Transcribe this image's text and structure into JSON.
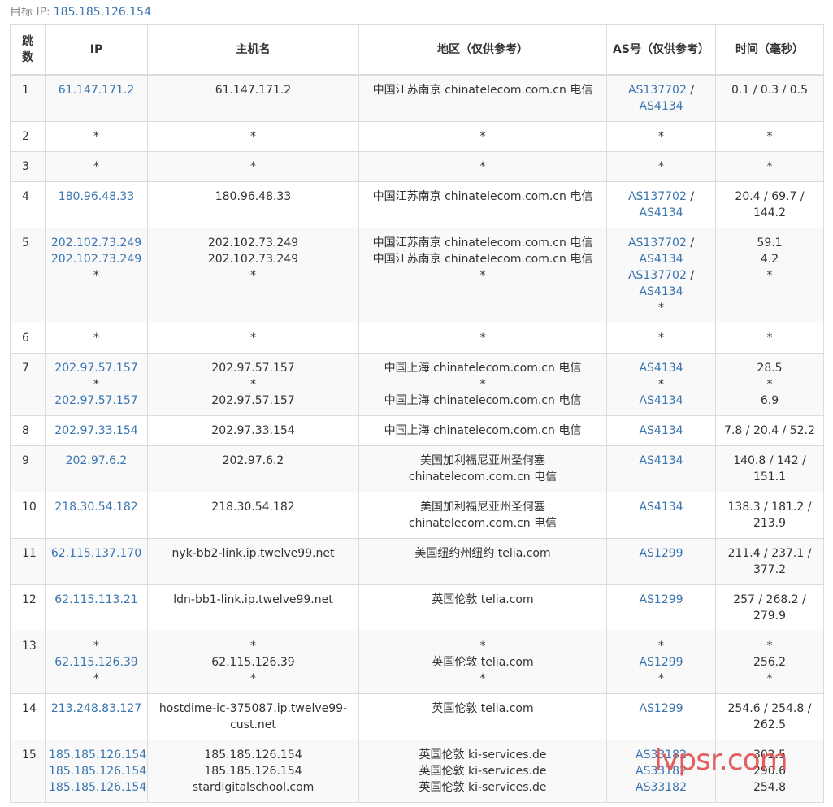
{
  "target": {
    "label": "目标 IP:",
    "ip": "185.185.126.154"
  },
  "headers": [
    "跳数",
    "IP",
    "主机名",
    "地区（仅供参考）",
    "AS号（仅供参考）",
    "时间（毫秒）"
  ],
  "rows": [
    {
      "hop": "1",
      "ip": [
        "61.147.171.2"
      ],
      "host": [
        "61.147.171.2"
      ],
      "region": [
        "中国江苏南京 chinatelecom.com.cn 电信"
      ],
      "as": [
        {
          "a": "AS137702",
          "sep": " /"
        },
        {
          "a": "AS4134"
        }
      ],
      "time": [
        "0.1 / 0.3 / 0.5"
      ]
    },
    {
      "hop": "2",
      "ip": [
        "*"
      ],
      "host": [
        "*"
      ],
      "region": [
        "*"
      ],
      "as": [
        {
          "t": "*"
        }
      ],
      "time": [
        "*"
      ]
    },
    {
      "hop": "3",
      "ip": [
        "*"
      ],
      "host": [
        "*"
      ],
      "region": [
        "*"
      ],
      "as": [
        {
          "t": "*"
        }
      ],
      "time": [
        "*"
      ]
    },
    {
      "hop": "4",
      "ip": [
        "180.96.48.33"
      ],
      "host": [
        "180.96.48.33"
      ],
      "region": [
        "中国江苏南京 chinatelecom.com.cn 电信"
      ],
      "as": [
        {
          "a": "AS137702",
          "sep": " /"
        },
        {
          "a": "AS4134"
        }
      ],
      "time": [
        "20.4 / 69.7 /",
        "144.2"
      ]
    },
    {
      "hop": "5",
      "ip": [
        "202.102.73.249",
        "202.102.73.249",
        "*"
      ],
      "host": [
        "202.102.73.249",
        "202.102.73.249",
        "*"
      ],
      "region": [
        "中国江苏南京 chinatelecom.com.cn 电信",
        "中国江苏南京 chinatelecom.com.cn 电信",
        "*"
      ],
      "as": [
        {
          "a": "AS137702",
          "sep": " /"
        },
        {
          "a": "AS4134"
        },
        {
          "a": "AS137702",
          "sep": " /"
        },
        {
          "a": "AS4134"
        },
        {
          "t": "*"
        }
      ],
      "time": [
        "59.1",
        "4.2",
        "*"
      ]
    },
    {
      "hop": "6",
      "ip": [
        "*"
      ],
      "host": [
        "*"
      ],
      "region": [
        "*"
      ],
      "as": [
        {
          "t": "*"
        }
      ],
      "time": [
        "*"
      ]
    },
    {
      "hop": "7",
      "ip": [
        "202.97.57.157",
        "*",
        "202.97.57.157"
      ],
      "host": [
        "202.97.57.157",
        "*",
        "202.97.57.157"
      ],
      "region": [
        "中国上海 chinatelecom.com.cn 电信",
        "*",
        "中国上海 chinatelecom.com.cn 电信"
      ],
      "as": [
        {
          "a": "AS4134"
        },
        {
          "t": "*"
        },
        {
          "a": "AS4134"
        }
      ],
      "time": [
        "28.5",
        "*",
        "6.9"
      ]
    },
    {
      "hop": "8",
      "ip": [
        "202.97.33.154"
      ],
      "host": [
        "202.97.33.154"
      ],
      "region": [
        "中国上海 chinatelecom.com.cn 电信"
      ],
      "as": [
        {
          "a": "AS4134"
        }
      ],
      "time": [
        "7.8 / 20.4 / 52.2"
      ]
    },
    {
      "hop": "9",
      "ip": [
        "202.97.6.2"
      ],
      "host": [
        "202.97.6.2"
      ],
      "region": [
        "美国加利福尼亚州圣何塞",
        "chinatelecom.com.cn 电信"
      ],
      "as": [
        {
          "a": "AS4134"
        }
      ],
      "time": [
        "140.8 / 142 /",
        "151.1"
      ]
    },
    {
      "hop": "10",
      "ip": [
        "218.30.54.182"
      ],
      "host": [
        "218.30.54.182"
      ],
      "region": [
        "美国加利福尼亚州圣何塞",
        "chinatelecom.com.cn 电信"
      ],
      "as": [
        {
          "a": "AS4134"
        }
      ],
      "time": [
        "138.3 / 181.2 /",
        "213.9"
      ]
    },
    {
      "hop": "11",
      "ip": [
        "62.115.137.170"
      ],
      "host": [
        "nyk-bb2-link.ip.twelve99.net"
      ],
      "region": [
        "美国纽约州纽约 telia.com"
      ],
      "as": [
        {
          "a": "AS1299"
        }
      ],
      "time": [
        "211.4 / 237.1 /",
        "377.2"
      ]
    },
    {
      "hop": "12",
      "ip": [
        "62.115.113.21"
      ],
      "host": [
        "ldn-bb1-link.ip.twelve99.net"
      ],
      "region": [
        "英国伦敦 telia.com"
      ],
      "as": [
        {
          "a": "AS1299"
        }
      ],
      "time": [
        "257 / 268.2 /",
        "279.9"
      ]
    },
    {
      "hop": "13",
      "ip": [
        "*",
        "62.115.126.39",
        "*"
      ],
      "host": [
        "*",
        "62.115.126.39",
        "*"
      ],
      "region": [
        "*",
        "英国伦敦 telia.com",
        "*"
      ],
      "as": [
        {
          "t": "*"
        },
        {
          "a": "AS1299"
        },
        {
          "t": "*"
        }
      ],
      "time": [
        "*",
        "256.2",
        "*"
      ]
    },
    {
      "hop": "14",
      "ip": [
        "213.248.83.127"
      ],
      "host": [
        "hostdime-ic-375087.ip.twelve99-",
        "cust.net"
      ],
      "region": [
        "英国伦敦 telia.com"
      ],
      "as": [
        {
          "a": "AS1299"
        }
      ],
      "time": [
        "254.6 / 254.8 /",
        "262.5"
      ]
    },
    {
      "hop": "15",
      "ip": [
        "185.185.126.154",
        "185.185.126.154",
        "185.185.126.154"
      ],
      "host": [
        "185.185.126.154",
        "185.185.126.154",
        "stardigitalschool.com"
      ],
      "region": [
        "英国伦敦 ki-services.de",
        "英国伦敦 ki-services.de",
        "英国伦敦 ki-services.de"
      ],
      "as": [
        {
          "a": "AS33182"
        },
        {
          "a": "AS33182"
        },
        {
          "a": "AS33182"
        }
      ],
      "time": [
        "302.5",
        "290.6",
        "254.8"
      ]
    }
  ],
  "watermark": "lvpsr.com",
  "colors": {
    "link": "#3a75b0",
    "border": "#dcdcdc",
    "stripe": "#f9f9f9",
    "watermark": "#e05050"
  }
}
